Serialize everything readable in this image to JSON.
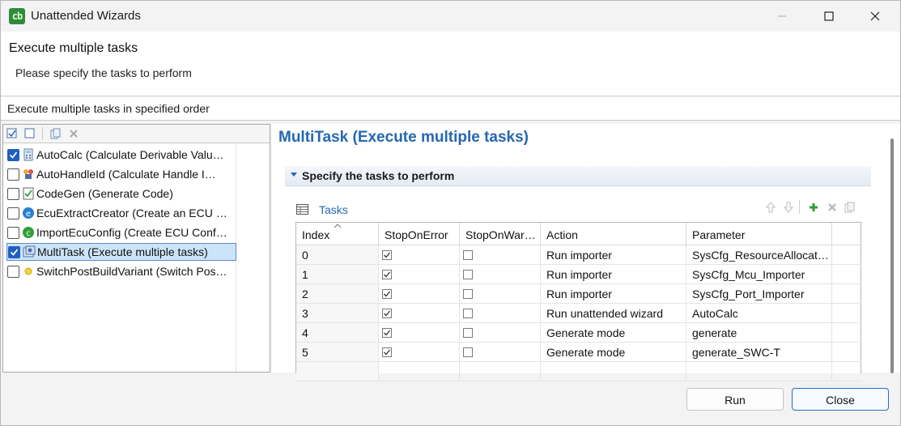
{
  "window": {
    "title": "Unattended Wizards"
  },
  "header": {
    "title": "Execute multiple tasks",
    "description": "Please specify the tasks to perform",
    "subtitle": "Execute multiple tasks in specified order"
  },
  "tree": {
    "items": [
      {
        "label": "AutoCalc (Calculate Derivable Valu…",
        "checked": true,
        "icon": "calculator-icon"
      },
      {
        "label": "AutoHandleId (Calculate Handle I…",
        "checked": false,
        "icon": "handle-icon"
      },
      {
        "label": "CodeGen (Generate Code)",
        "checked": false,
        "icon": "codegen-icon"
      },
      {
        "label": "EcuExtractCreator (Create an ECU …",
        "checked": false,
        "icon": "ecu-extract-icon"
      },
      {
        "label": "ImportEcuConfig (Create ECU Conf…",
        "checked": false,
        "icon": "import-ecu-icon"
      },
      {
        "label": "MultiTask (Execute multiple tasks)",
        "checked": true,
        "icon": "multitask-icon",
        "selected": true
      },
      {
        "label": "SwitchPostBuildVariant (Switch Pos…",
        "checked": false,
        "icon": "switch-variant-icon"
      }
    ]
  },
  "right": {
    "title": "MultiTask (Execute multiple tasks)",
    "section": "Specify the tasks to perform",
    "tasks_label": "Tasks"
  },
  "table": {
    "columns": [
      "Index",
      "StopOnError",
      "StopOnWar…",
      "Action",
      "Parameter"
    ],
    "rows": [
      {
        "index": "0",
        "stopOnError": true,
        "stopOnWarning": false,
        "action": "Run importer",
        "parameter": "SysCfg_ResourceAllocat…"
      },
      {
        "index": "1",
        "stopOnError": true,
        "stopOnWarning": false,
        "action": "Run importer",
        "parameter": "SysCfg_Mcu_Importer"
      },
      {
        "index": "2",
        "stopOnError": true,
        "stopOnWarning": false,
        "action": "Run importer",
        "parameter": "SysCfg_Port_Importer"
      },
      {
        "index": "3",
        "stopOnError": true,
        "stopOnWarning": false,
        "action": "Run unattended wizard",
        "parameter": "AutoCalc"
      },
      {
        "index": "4",
        "stopOnError": true,
        "stopOnWarning": false,
        "action": "Generate mode",
        "parameter": "generate"
      },
      {
        "index": "5",
        "stopOnError": true,
        "stopOnWarning": false,
        "action": "Generate mode",
        "parameter": "generate_SWC-T"
      }
    ]
  },
  "buttons": {
    "run": "Run",
    "close": "Close"
  },
  "colors": {
    "accent": "#2467b3",
    "checkbox": "#1e5fbf",
    "selection": "#cce4f7"
  }
}
